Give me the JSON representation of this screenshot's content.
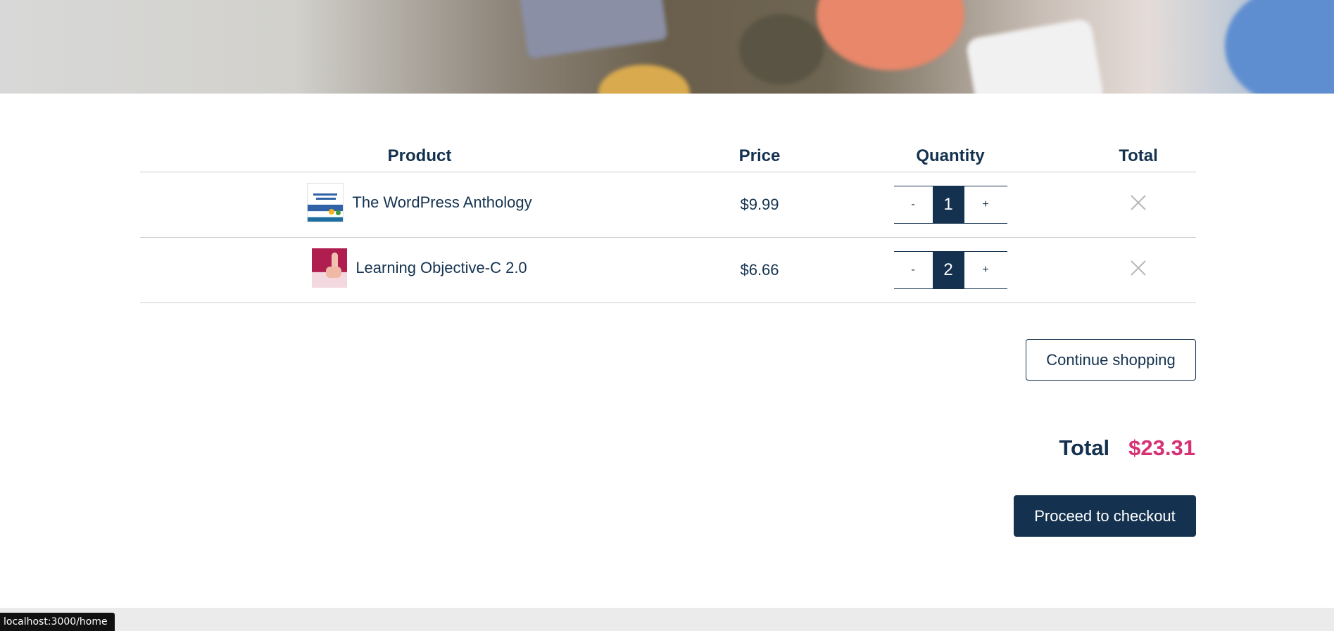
{
  "table": {
    "headers": {
      "product": "Product",
      "price": "Price",
      "quantity": "Quantity",
      "total": "Total"
    },
    "items": [
      {
        "name": "The WordPress Anthology",
        "price": "$9.99",
        "quantity": "1",
        "decrement": "-",
        "increment": "+",
        "thumbnail": "wordpress-anthology-cover"
      },
      {
        "name": "Learning Objective-C 2.0",
        "price": "$6.66",
        "quantity": "2",
        "decrement": "-",
        "increment": "+",
        "thumbnail": "learning-objective-c-cover"
      }
    ],
    "remove_icon": "close-icon"
  },
  "actions": {
    "continue_label": "Continue shopping",
    "checkout_label": "Proceed to checkout"
  },
  "summary": {
    "total_label": "Total",
    "total_value": "$23.31"
  },
  "status_bar": {
    "url": "localhost:3000/home"
  },
  "colors": {
    "primary": "#14324f",
    "accent": "#d63175",
    "border": "#cfcfcf",
    "footer": "#ebebeb"
  }
}
